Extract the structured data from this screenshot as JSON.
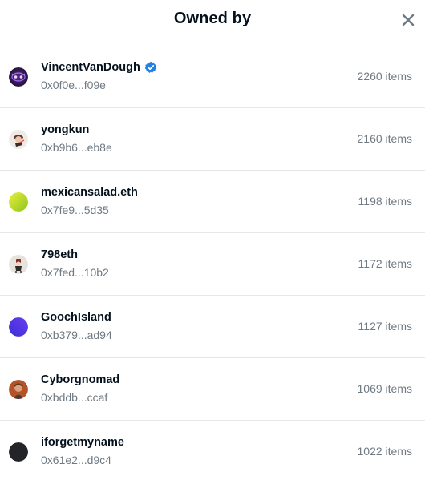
{
  "dialog": {
    "title": "Owned by",
    "close_icon": "close-icon"
  },
  "owners": [
    {
      "name": "VincentVanDough",
      "verified": true,
      "address": "0x0f0e...f09e",
      "count": "2260 items",
      "avatar": "dark-purple-avatar-icon"
    },
    {
      "name": "yongkun",
      "verified": false,
      "address": "0xb9b6...eb8e",
      "count": "2160 items",
      "avatar": "character-avatar-icon"
    },
    {
      "name": "mexicansalad.eth",
      "verified": false,
      "address": "0x7fe9...5d35",
      "count": "1198 items",
      "avatar": "yellow-green-gradient-avatar-icon"
    },
    {
      "name": "798eth",
      "verified": false,
      "address": "0x7fed...10b2",
      "count": "1172 items",
      "avatar": "figure-avatar-icon"
    },
    {
      "name": "GoochIsland",
      "verified": false,
      "address": "0xb379...ad94",
      "count": "1127 items",
      "avatar": "blue-purple-gradient-avatar-icon"
    },
    {
      "name": "Cyborgnomad",
      "verified": false,
      "address": "0xbddb...ccaf",
      "count": "1069 items",
      "avatar": "portrait-avatar-icon"
    },
    {
      "name": "iforgetmyname",
      "verified": false,
      "address": "0x61e2...d9c4",
      "count": "1022 items",
      "avatar": "black-avatar-icon"
    }
  ],
  "colors": {
    "text_primary": "#04111d",
    "text_secondary": "#707a83",
    "divider": "#e5e8eb",
    "verified_badge": "#2081e2"
  }
}
